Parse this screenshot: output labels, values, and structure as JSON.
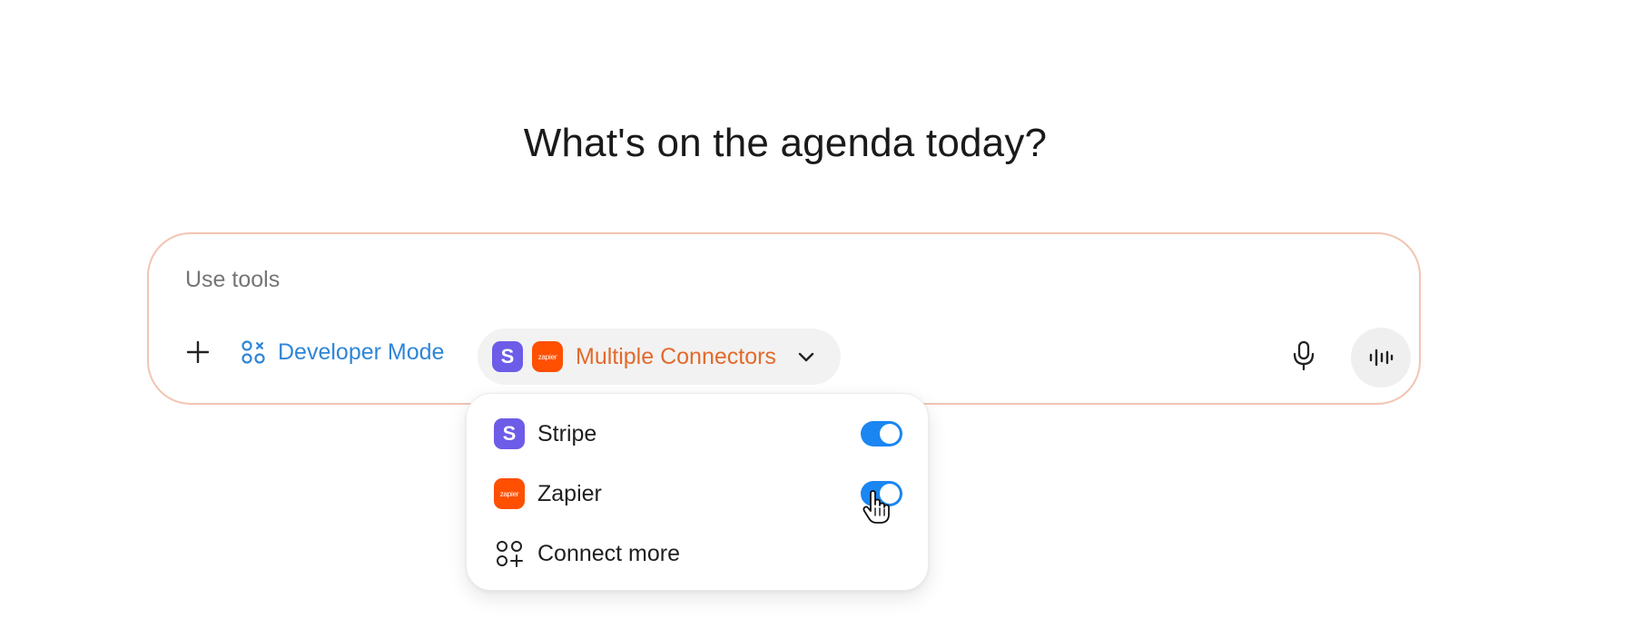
{
  "headline": "What's on the agenda today?",
  "composer": {
    "placeholder": "Use tools",
    "developer_mode_label": "Developer Mode",
    "connectors_label": "Multiple Connectors",
    "stripe_icon_letter": "S",
    "zapier_icon_text": "zapier"
  },
  "dropdown": {
    "items": [
      {
        "label": "Stripe",
        "icon": "stripe-icon",
        "enabled": true
      },
      {
        "label": "Zapier",
        "icon": "zapier-icon",
        "enabled": true
      }
    ],
    "connect_more_label": "Connect more"
  },
  "colors": {
    "accent_blue": "#2f86d6",
    "toggle_blue": "#1a86f2",
    "connector_orange": "#e26a2c",
    "composer_border": "#f2c4b2",
    "stripe_purple": "#6c5ce7",
    "zapier_orange": "#ff4f00"
  }
}
